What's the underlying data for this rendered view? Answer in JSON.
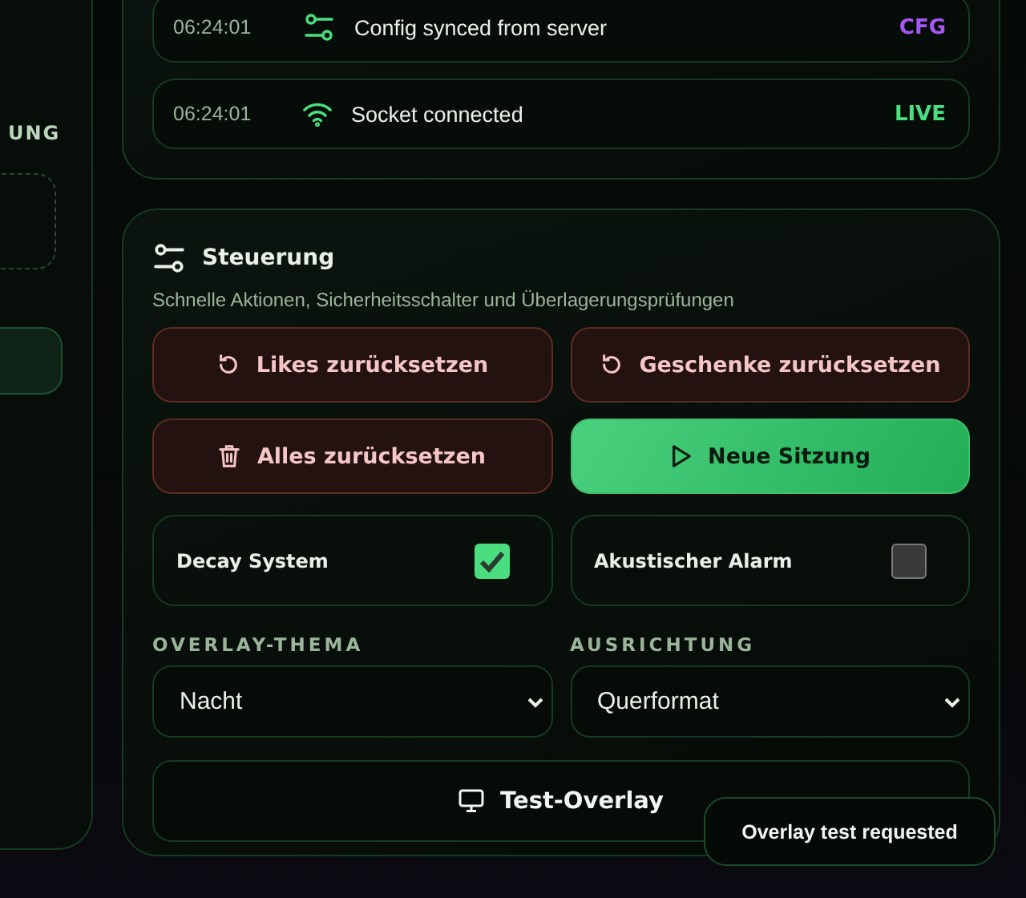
{
  "sidebar": {
    "heading": "UNG"
  },
  "log": {
    "entries": [
      {
        "time": "06:24:01",
        "message": "Config synced from server",
        "tag": "CFG",
        "color": "#a855f7"
      },
      {
        "time": "06:24:01",
        "message": "Socket connected",
        "tag": "LIVE",
        "color": "#4ade80"
      }
    ]
  },
  "controls": {
    "title": "Steuerung",
    "subtitle": "Schnelle Aktionen, Sicherheitsschalter und Überlagerungsprüfungen",
    "actions": [
      {
        "label": "Likes zurücksetzen",
        "kind": "danger"
      },
      {
        "label": "Geschenke zurücksetzen",
        "kind": "danger"
      },
      {
        "label": "Alles zurücksetzen",
        "kind": "danger"
      },
      {
        "label": "Neue Sitzung",
        "kind": "primary"
      }
    ],
    "toggles": [
      {
        "label": "Decay System",
        "checked": true
      },
      {
        "label": "Akustischer Alarm",
        "checked": false
      }
    ],
    "selects": [
      {
        "label": "OVERLAY-THEMA",
        "value": "Nacht"
      },
      {
        "label": "AUSRICHTUNG",
        "value": "Querformat"
      }
    ],
    "test_button": {
      "label": "Test-Overlay"
    }
  },
  "toast": {
    "message": "Overlay test requested"
  }
}
